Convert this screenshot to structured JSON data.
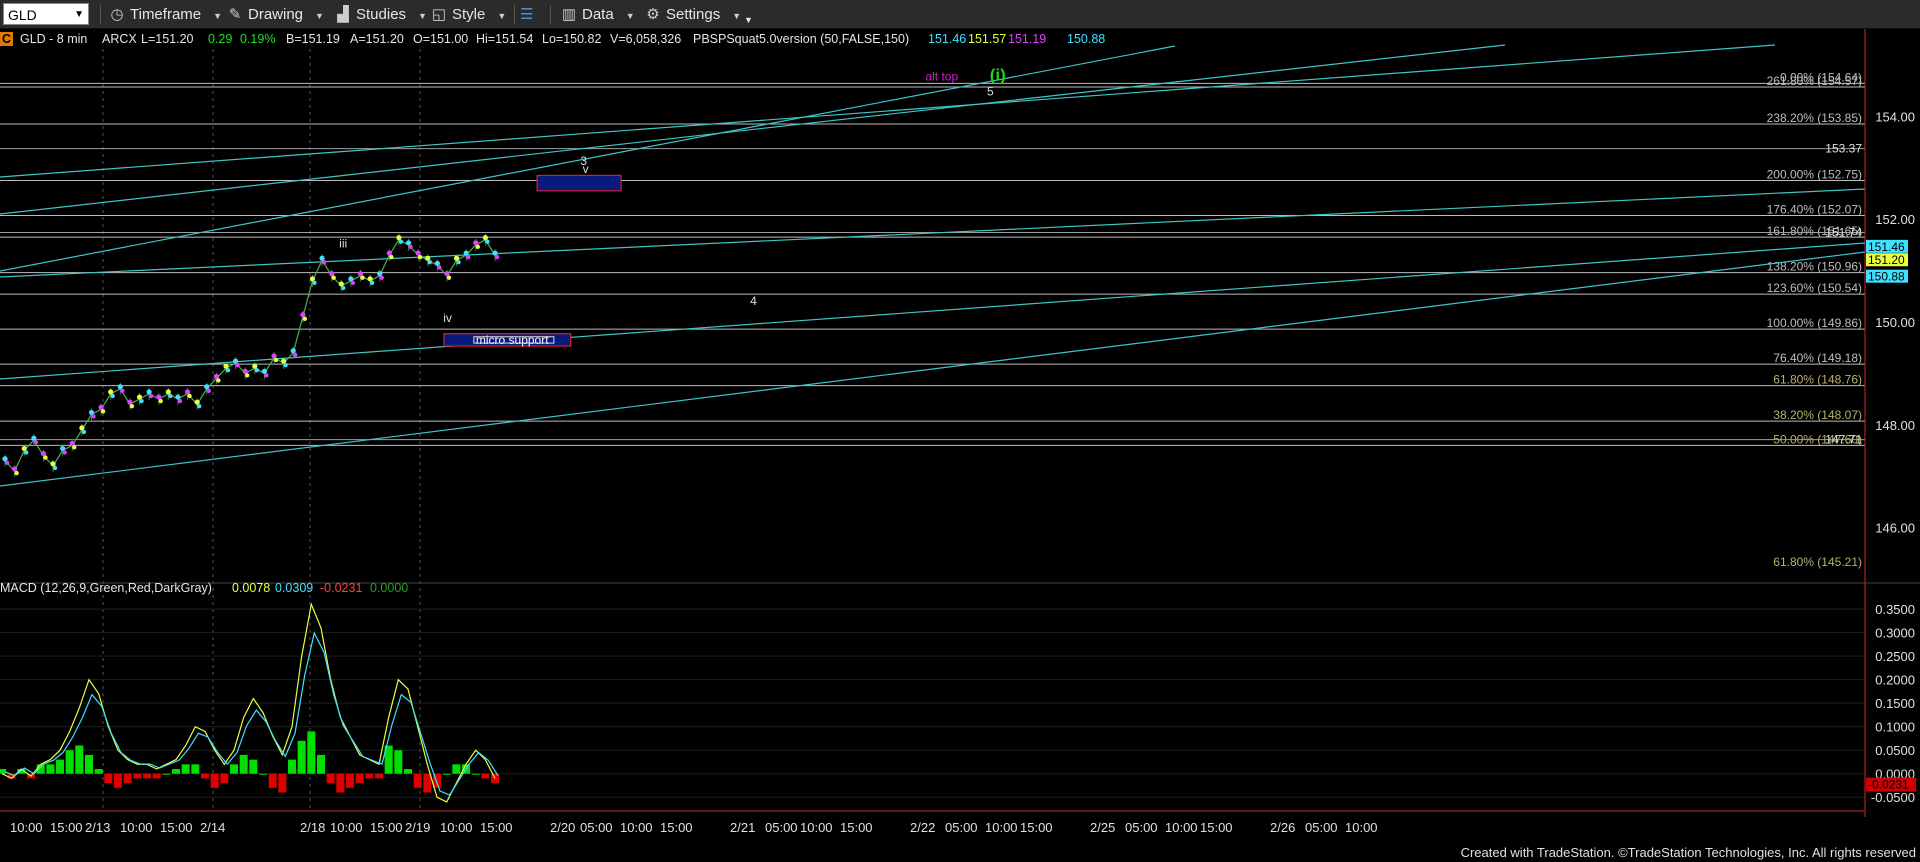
{
  "toolbar": {
    "symbol": "GLD",
    "buttons": [
      "Timeframe",
      "Drawing",
      "Studies",
      "Style",
      "Data",
      "Settings"
    ]
  },
  "header": {
    "marker": "C",
    "symbol": "GLD - 8 min",
    "exchange": "ARCX",
    "last": "L=151.20",
    "change": "0.29",
    "change_pct": "0.19%",
    "bid": "B=151.19",
    "ask": "A=151.20",
    "open": "O=151.00",
    "hi": "Hi=151.54",
    "lo": "Lo=150.82",
    "volume": "V=6,058,326",
    "study": "PBSPSquat5.0version (50,FALSE,150)",
    "study_values": [
      "151.46",
      "151.57",
      "151.19",
      "150.88"
    ]
  },
  "colors": {
    "background": "#000000",
    "grid": "#3a3a3a",
    "fib_line": "#bdbdbd",
    "channel": "#3ec6c6",
    "axis_border": "#c62828",
    "macd_pos": "#00e000",
    "macd_neg": "#e00000",
    "candle_cyan": "#40e0ff",
    "candle_magenta": "#e040ff",
    "candle_yellow": "#e8ff40",
    "box_fill": "#0a1a7a",
    "box_border": "#cc2233"
  },
  "chart_data": [
    {
      "type": "line",
      "name": "price",
      "ylim": [
        145.0,
        155.6
      ],
      "yticks": [
        146.0,
        148.0,
        150.0,
        152.0,
        154.0
      ],
      "xticks": [
        "10:00",
        "15:00",
        "2/13",
        "10:00",
        "15:00",
        "2/14",
        "2/18",
        "10:00",
        "15:00",
        "2/19",
        "10:00",
        "15:00",
        "2/20",
        "05:00",
        "10:00",
        "15:00",
        "2/21",
        "05:00",
        "10:00",
        "15:00",
        "2/22",
        "05:00",
        "10:00",
        "15:00",
        "2/25",
        "05:00",
        "10:00",
        "15:00",
        "2/26",
        "05:00",
        "10:00"
      ],
      "price_path": [
        147.3,
        147.1,
        147.5,
        147.7,
        147.4,
        147.2,
        147.5,
        147.6,
        147.9,
        148.2,
        148.3,
        148.6,
        148.7,
        148.4,
        148.5,
        148.6,
        148.5,
        148.6,
        148.5,
        148.6,
        148.4,
        148.7,
        148.9,
        149.1,
        149.2,
        149.0,
        149.1,
        149.0,
        149.3,
        149.2,
        149.4,
        150.1,
        150.8,
        151.2,
        150.9,
        150.7,
        150.8,
        150.9,
        150.8,
        150.9,
        151.3,
        151.6,
        151.5,
        151.3,
        151.2,
        151.1,
        150.9,
        151.2,
        151.3,
        151.5,
        151.6,
        151.3
      ],
      "fib_levels": [
        {
          "label": "0.00% (154.64)",
          "value": 154.64
        },
        {
          "label": "261.80% (154.57)",
          "value": 154.57
        },
        {
          "label": "238.20% (153.85)",
          "value": 153.85
        },
        {
          "label": "200.00% (152.75)",
          "value": 152.75
        },
        {
          "label": "176.40% (152.07)",
          "value": 152.07
        },
        {
          "label": "161.80% (151.65)",
          "value": 151.65
        },
        {
          "label": "138.20% (150.96)",
          "value": 150.96
        },
        {
          "label": "123.60% (150.54)",
          "value": 150.54
        },
        {
          "label": "100.00% (149.86)",
          "value": 149.86
        },
        {
          "label": "76.40% (149.18)",
          "value": 149.18
        },
        {
          "label": "61.80% (148.76)",
          "value": 148.76
        },
        {
          "label": "38.20% (148.07)",
          "value": 148.07
        },
        {
          "label": "50.00% (147.60)",
          "value": 147.6
        },
        {
          "label": "61.80% (145.21)",
          "value": 145.21
        }
      ],
      "price_markers": [
        {
          "label": "153.37",
          "value": 153.37
        },
        {
          "label": "151.74",
          "value": 151.74
        },
        {
          "label": "151.46",
          "value": 151.46,
          "color": "#40e0ff"
        },
        {
          "label": "151.20",
          "value": 151.2,
          "color": "#e8ff40"
        },
        {
          "label": "150.88",
          "value": 150.88,
          "color": "#40e0ff"
        },
        {
          "label": "147.71",
          "value": 147.71
        }
      ],
      "annotations": [
        {
          "text": "alt top",
          "color": "#d020d0",
          "x": 0.505,
          "y": 154.7
        },
        {
          "text": "(i)",
          "color": "#20d020",
          "x": 0.535,
          "y": 154.7
        },
        {
          "text": "5",
          "color": "#dddddd",
          "x": 0.531,
          "y": 154.4
        },
        {
          "text": "3",
          "color": "#dddddd",
          "x": 0.313,
          "y": 153.05
        },
        {
          "text": "v",
          "color": "#dddddd",
          "x": 0.314,
          "y": 152.9
        },
        {
          "text": "iii",
          "color": "#dddddd",
          "x": 0.184,
          "y": 151.45
        },
        {
          "text": "iv",
          "color": "#dddddd",
          "x": 0.24,
          "y": 150.0
        },
        {
          "text": "4",
          "color": "#dddddd",
          "x": 0.404,
          "y": 150.33
        }
      ],
      "boxes": [
        {
          "label": "",
          "x0": 0.288,
          "x1": 0.333,
          "y0": 152.55,
          "y1": 152.85
        },
        {
          "label": "micro support",
          "x0": 0.238,
          "x1": 0.306,
          "y0": 149.53,
          "y1": 149.77
        }
      ]
    },
    {
      "type": "bar",
      "name": "MACD (12,26,9,Green,Red,DarkGray)",
      "legend_values": [
        {
          "text": "0.0078",
          "color": "#e8ff40"
        },
        {
          "text": "0.0309",
          "color": "#40e0ff"
        },
        {
          "text": "-0.0231",
          "color": "#ff4040"
        },
        {
          "text": "0.0000",
          "color": "#20a020"
        }
      ],
      "ylim": [
        -0.075,
        0.38
      ],
      "yticks": [
        -0.05,
        0.0,
        0.05,
        0.1,
        0.15,
        0.2,
        0.25,
        0.3,
        0.35
      ],
      "ytick_labels": [
        "-0.0500",
        "0.0000",
        "0.0500",
        "0.1000",
        "0.1500",
        "0.2000",
        "0.2500",
        "0.3000",
        "0.3500"
      ],
      "last_value_label": "-0.0231",
      "macd_path": [
        0.0,
        -0.01,
        0.01,
        -0.005,
        0.02,
        0.03,
        0.05,
        0.09,
        0.14,
        0.2,
        0.17,
        0.1,
        0.05,
        0.03,
        0.02,
        0.02,
        0.01,
        0.02,
        0.03,
        0.06,
        0.1,
        0.09,
        0.05,
        0.02,
        0.05,
        0.12,
        0.16,
        0.13,
        0.08,
        0.04,
        0.1,
        0.25,
        0.36,
        0.31,
        0.2,
        0.12,
        0.08,
        0.04,
        0.03,
        0.02,
        0.12,
        0.2,
        0.18,
        0.1,
        0.02,
        -0.05,
        -0.06,
        -0.02,
        0.02,
        0.05,
        0.03,
        -0.01
      ],
      "hist_path": [
        0.01,
        -0.01,
        0.01,
        -0.01,
        0.02,
        0.02,
        0.03,
        0.05,
        0.06,
        0.04,
        0.01,
        -0.02,
        -0.03,
        -0.02,
        -0.01,
        -0.01,
        -0.01,
        0.0,
        0.01,
        0.02,
        0.02,
        -0.01,
        -0.03,
        -0.02,
        0.02,
        0.04,
        0.03,
        0.0,
        -0.03,
        -0.04,
        0.03,
        0.07,
        0.09,
        0.04,
        -0.02,
        -0.04,
        -0.03,
        -0.02,
        -0.01,
        -0.01,
        0.06,
        0.05,
        0.01,
        -0.03,
        -0.04,
        -0.03,
        0.0,
        0.02,
        0.02,
        0.0,
        -0.01,
        -0.02
      ]
    }
  ],
  "footer": "Created with TradeStation. ©TradeStation Technologies, Inc. All rights reserved"
}
